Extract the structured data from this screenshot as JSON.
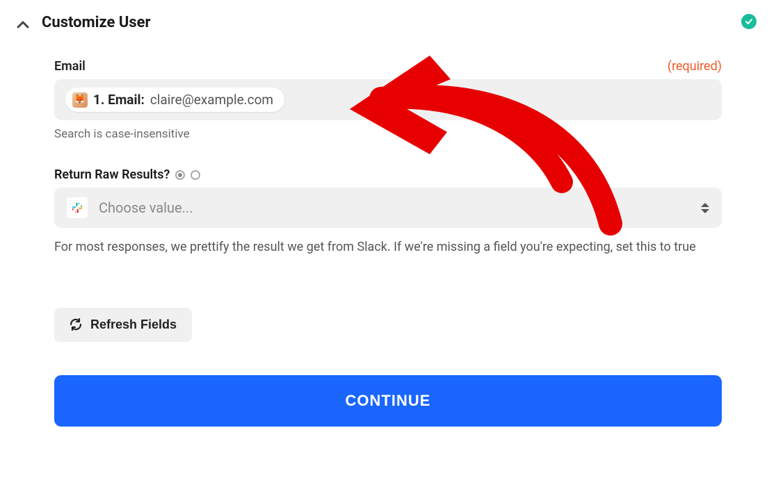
{
  "header": {
    "title": "Customize User",
    "status": "complete"
  },
  "emailField": {
    "label": "Email",
    "requiredTag": "(required)",
    "pill": {
      "prefix": "1. Email:",
      "value": "claire@example.com"
    },
    "helper": "Search is case-insensitive"
  },
  "rawResults": {
    "label": "Return Raw Results?",
    "placeholder": "Choose value...",
    "description": "For most responses, we prettify the result we get from Slack. If we're missing a field you're expecting, set this to true"
  },
  "refresh": {
    "label": "Refresh Fields"
  },
  "continue": {
    "label": "CONTINUE"
  }
}
